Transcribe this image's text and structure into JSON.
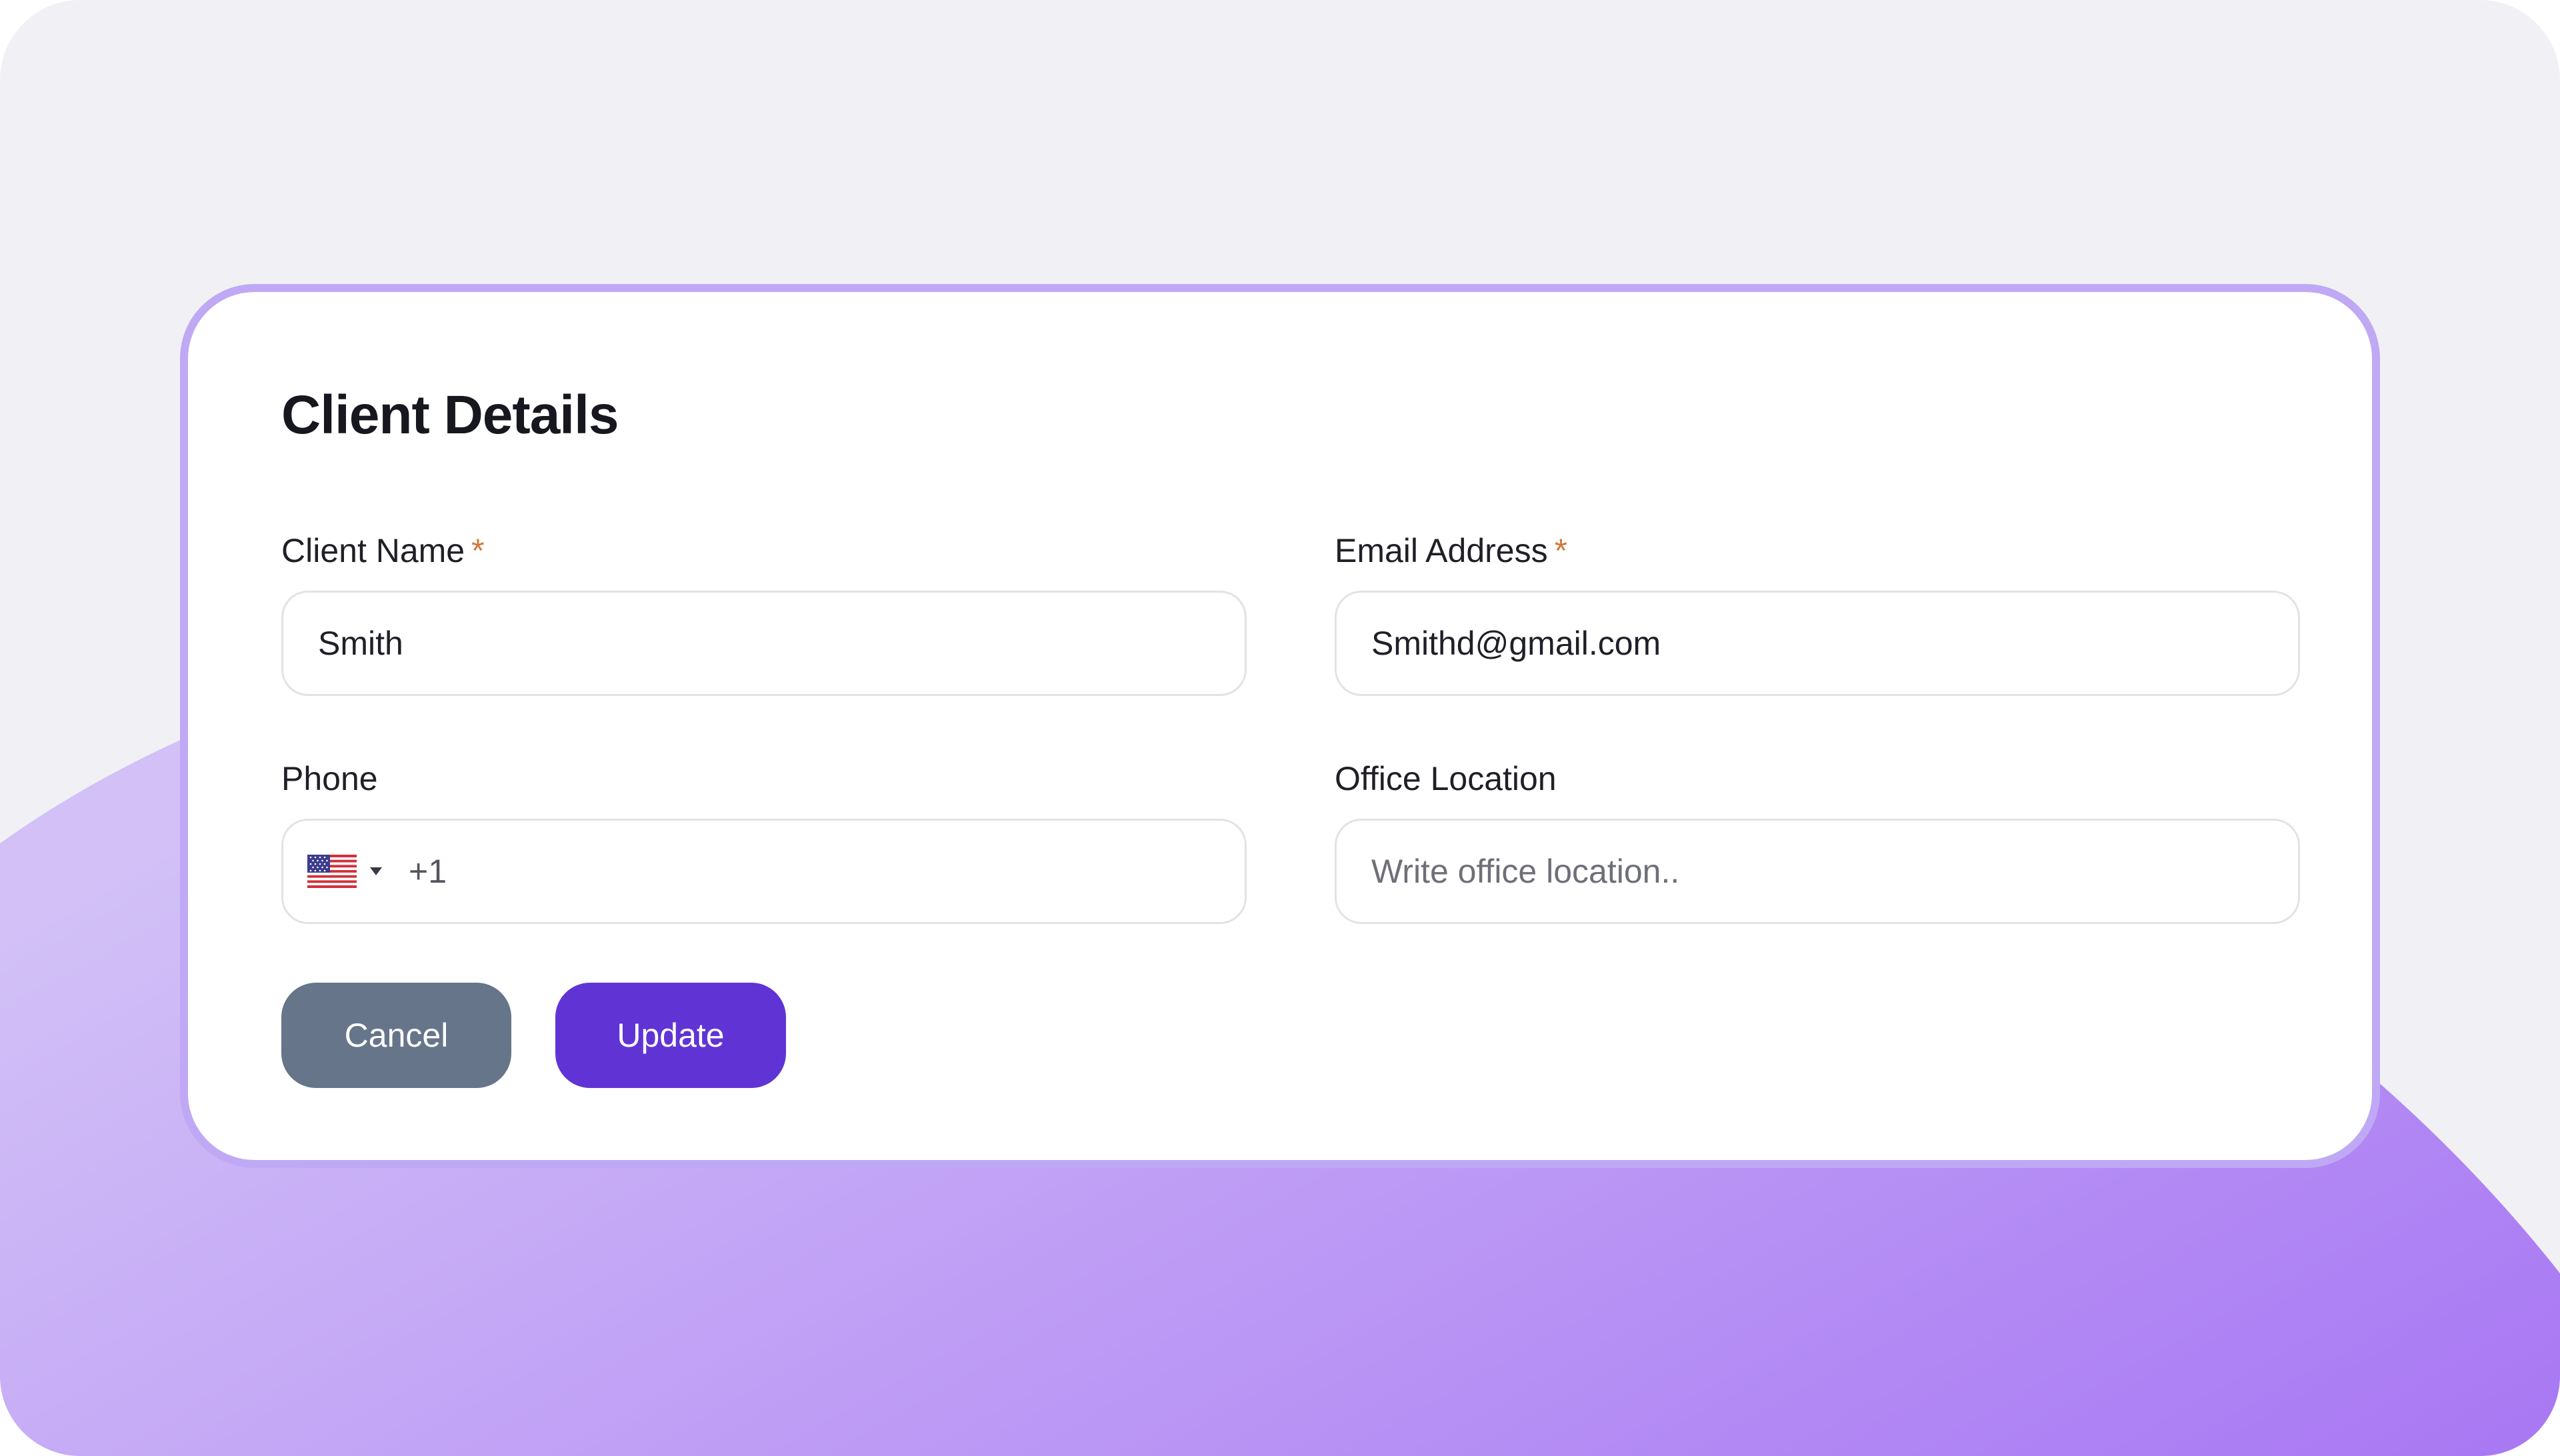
{
  "colors": {
    "background": "#f1f1f5",
    "wave_start": "#cdb9f6",
    "wave_end": "#a97bf3",
    "card_border": "#bfa9f5",
    "required_star": "#d0783a",
    "cancel_button": "#66758a",
    "update_button": "#6034d4"
  },
  "form": {
    "title": "Client Details",
    "required_marker": "*",
    "client_name": {
      "label": "Client Name",
      "value": "Smith"
    },
    "email": {
      "label": "Email Address",
      "value": "Smithd@gmail.com"
    },
    "phone": {
      "label": "Phone",
      "country_icon": "us-flag-icon",
      "dial_code": "+1",
      "value": ""
    },
    "office_location": {
      "label": "Office Location",
      "value": "",
      "placeholder": "Write office location.."
    }
  },
  "actions": {
    "cancel_label": "Cancel",
    "update_label": "Update"
  }
}
